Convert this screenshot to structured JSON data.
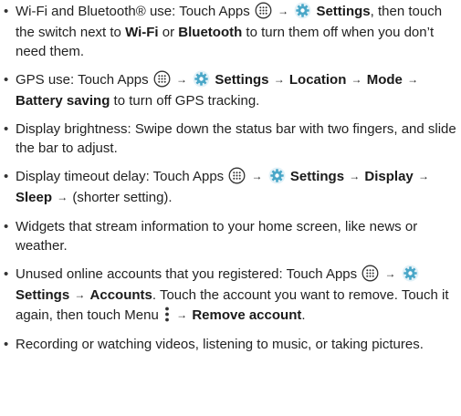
{
  "colors": {
    "text": "#222222",
    "gear": "#4aa7c8",
    "icon_outline": "#333333"
  },
  "icons": {
    "apps": "apps-launcher-icon",
    "settings": "settings-gear-icon",
    "menu": "menu-overflow-icon"
  },
  "tips": [
    {
      "lead": "Wi-Fi and Bluetooth® use: Touch Apps",
      "after_apps": "Settings",
      "t1": ", then touch the switch next to ",
      "b1": "Wi-Fi",
      "t2": " or ",
      "b2": "Bluetooth",
      "t3": " to turn them off when you don’t need them."
    },
    {
      "lead": "GPS use: Touch Apps",
      "b_settings": "Settings",
      "b_location": "Location",
      "b_mode": "Mode",
      "b_battery": "Battery saving",
      "tail": " to turn off GPS tracking."
    },
    {
      "text": "Display brightness: Swipe down the status bar with two fingers, and slide the bar to adjust."
    },
    {
      "lead": "Display timeout delay: Touch Apps",
      "b_settings": "Settings",
      "b_display": "Display",
      "b_sleep": "Sleep",
      "tail": "(shorter setting)."
    },
    {
      "text": "Widgets that stream information to your home screen, like news or weather."
    },
    {
      "lead": "Unused online accounts that you registered: Touch Apps",
      "b_settings": "Settings",
      "b_accounts": "Accounts",
      "mid": ". Touch the account you want to remove. Touch it again, then touch Menu",
      "b_remove": "Remove account",
      "tail": "."
    },
    {
      "text": "Recording or watching videos, listening to music, or taking pictures."
    }
  ]
}
